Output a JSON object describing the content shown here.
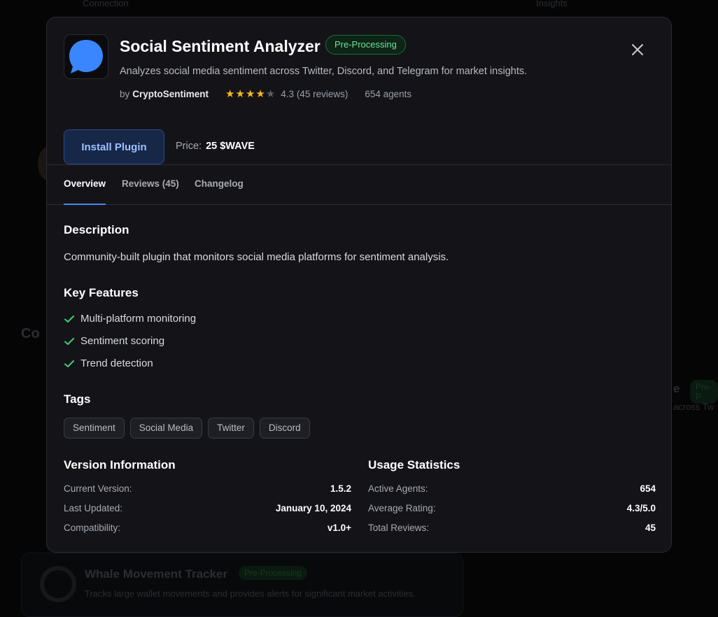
{
  "modal": {
    "title": "Social Sentiment Analyzer",
    "status_badge": "Pre-Processing",
    "subtitle": "Analyzes social media sentiment across Twitter, Discord, and Telegram for market insights.",
    "author_prefix": "by",
    "author": "CryptoSentiment",
    "rating": 4.3,
    "rating_stars_filled": 4,
    "rating_text": "4.3 (45 reviews)",
    "agents_text": "654 agents",
    "install_label": "Install Plugin",
    "price_label": "Price:",
    "price_value": "25 $WAVE",
    "close_icon": "close-icon",
    "plugin_icon": "chat-bubble-icon"
  },
  "tabs": [
    {
      "label": "Overview",
      "active": true
    },
    {
      "label": "Reviews (45)",
      "active": false
    },
    {
      "label": "Changelog",
      "active": false
    }
  ],
  "overview": {
    "description_heading": "Description",
    "description": "Community-built plugin that monitors social media platforms for sentiment analysis.",
    "features_heading": "Key Features",
    "features": [
      "Multi-platform monitoring",
      "Sentiment scoring",
      "Trend detection"
    ],
    "tags_heading": "Tags",
    "tags": [
      "Sentiment",
      "Social Media",
      "Twitter",
      "Discord"
    ],
    "version_heading": "Version Information",
    "version_rows": [
      {
        "label": "Current Version:",
        "value": "1.5.2"
      },
      {
        "label": "Last Updated:",
        "value": "January 10, 2024"
      },
      {
        "label": "Compatibility:",
        "value": "v1.0+"
      }
    ],
    "usage_heading": "Usage Statistics",
    "usage_rows": [
      {
        "label": "Active Agents:",
        "value": "654"
      },
      {
        "label": "Average Rating:",
        "value": "4.3/5.0"
      },
      {
        "label": "Total Reviews:",
        "value": "45"
      }
    ]
  },
  "background": {
    "fragment_top_left": "Connection",
    "fragment_top_right": "Insights",
    "section_heading_fragment": "Co",
    "card_title_fragment": "e",
    "card_badge_fragment": "Pre-P",
    "card_text_fragment": "across Tw",
    "bottom_card_title": "Whale Movement Tracker",
    "bottom_card_badge": "Pre-Processing",
    "bottom_card_desc": "Tracks large wallet movements and provides alerts for significant market activities."
  },
  "colors": {
    "accent": "#4b86f0",
    "status_green": "#6fe39b",
    "star_yellow": "#f5b623",
    "modal_bg": "#141418"
  }
}
